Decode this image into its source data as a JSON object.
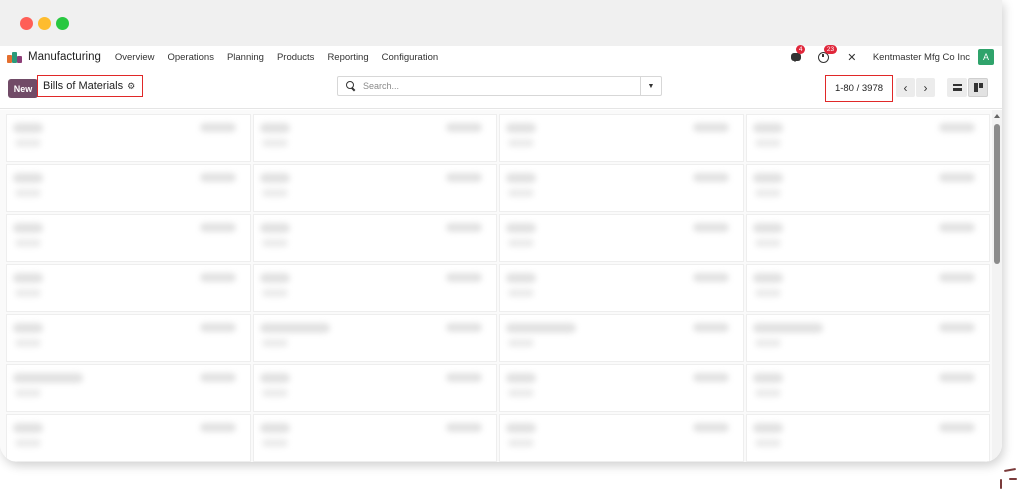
{
  "window": {
    "controls": [
      "close",
      "minimize",
      "maximize"
    ]
  },
  "navbar": {
    "app_name": "Manufacturing",
    "menu": [
      "Overview",
      "Operations",
      "Planning",
      "Products",
      "Reporting",
      "Configuration"
    ],
    "messages_count": "4",
    "activities_count": "23",
    "company": "Kentmaster Mfg Co Inc",
    "avatar_letter": "A"
  },
  "control_panel": {
    "new_label": "New",
    "breadcrumb": "Bills of Materials",
    "search_placeholder": "Search...",
    "pager": "1-80 / 3978"
  },
  "colors": {
    "brand": "#714b67",
    "highlight": "#e02828",
    "badge": "#e0273b",
    "avatar": "#2fa36b"
  },
  "icons": [
    "chat-icon",
    "clock-icon",
    "tools-icon",
    "gear-icon",
    "search-icon",
    "chevron-down-icon",
    "chevron-left-icon",
    "chevron-right-icon",
    "list-view-icon",
    "kanban-view-icon"
  ]
}
